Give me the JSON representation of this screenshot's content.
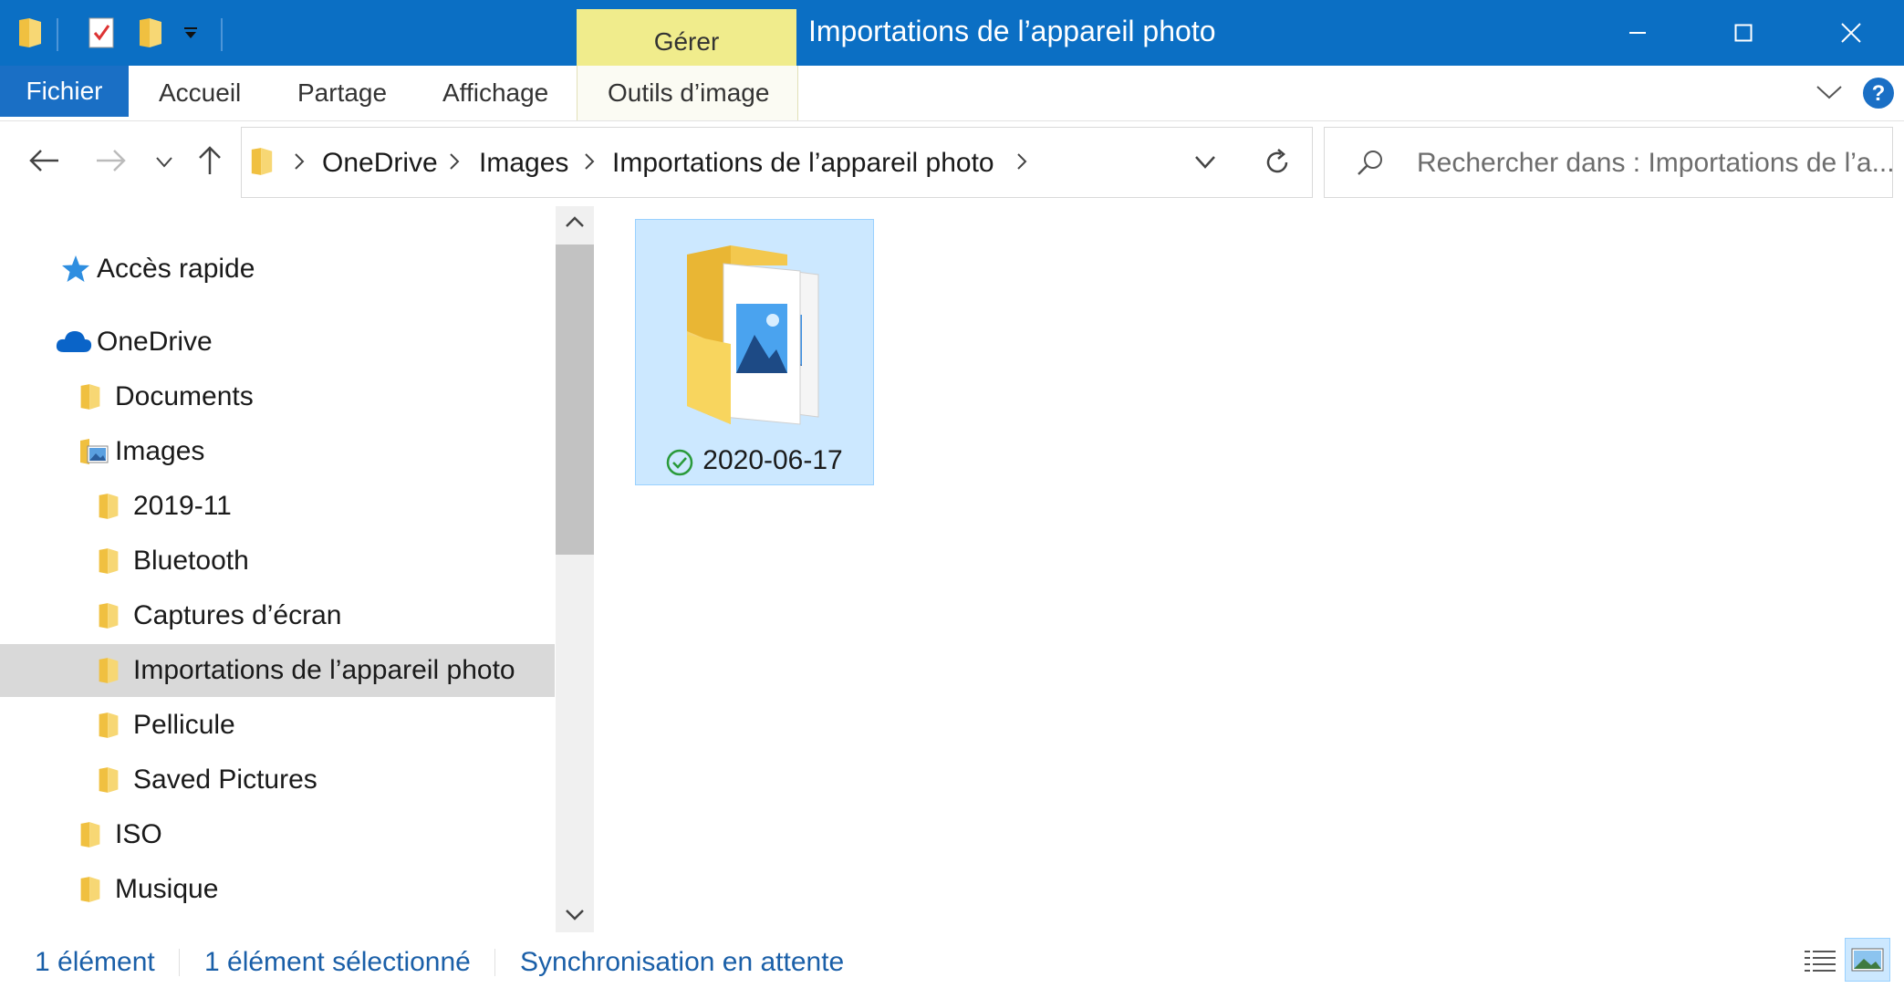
{
  "window": {
    "title": "Importations de l’appareil photo",
    "contextual_tab_group": "Gérer",
    "accent_color": "#0b6fc4"
  },
  "ribbon": {
    "tabs": [
      "Fichier",
      "Accueil",
      "Partage",
      "Affichage",
      "Outils d’image"
    ]
  },
  "address_bar": {
    "breadcrumbs": [
      "OneDrive",
      "Images",
      "Importations de l’appareil photo"
    ]
  },
  "search": {
    "placeholder": "Rechercher dans : Importations de l’a..."
  },
  "sidebar": {
    "items": [
      {
        "label": "Accès rapide",
        "icon": "star-icon"
      },
      {
        "label": "OneDrive",
        "icon": "onedrive-cloud-icon"
      },
      {
        "label": "Documents",
        "icon": "folder-icon"
      },
      {
        "label": "Images",
        "icon": "pictures-folder-icon"
      },
      {
        "label": "2019-11",
        "icon": "folder-icon"
      },
      {
        "label": "Bluetooth",
        "icon": "folder-icon"
      },
      {
        "label": "Captures d’écran",
        "icon": "folder-icon"
      },
      {
        "label": "Importations de l’appareil photo",
        "icon": "folder-icon",
        "selected": true
      },
      {
        "label": "Pellicule",
        "icon": "folder-icon"
      },
      {
        "label": "Saved Pictures",
        "icon": "folder-icon"
      },
      {
        "label": "ISO",
        "icon": "folder-icon"
      },
      {
        "label": "Musique",
        "icon": "folder-icon"
      }
    ]
  },
  "content": {
    "items": [
      {
        "name": "2020-06-17",
        "type": "folder",
        "sync_status": "synced-check-icon",
        "selected": true
      }
    ]
  },
  "status_bar": {
    "item_count": "1 élément",
    "selected_count": "1 élément sélectionné",
    "sync_status": "Synchronisation en attente"
  }
}
